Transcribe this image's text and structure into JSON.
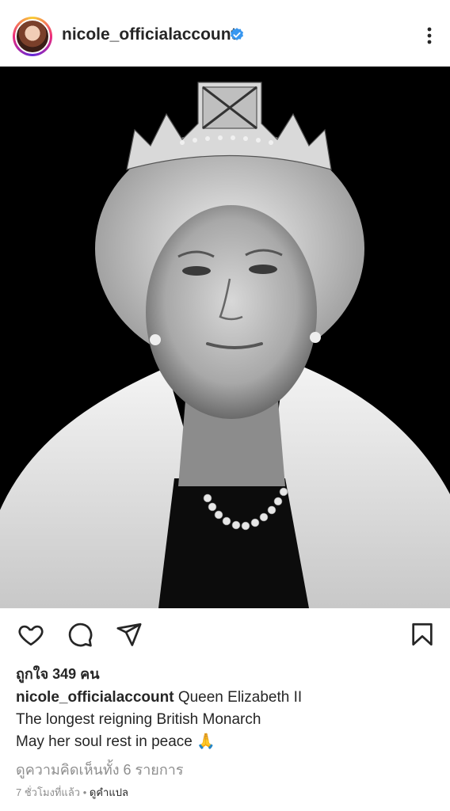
{
  "header": {
    "username": "nicole_officialaccount",
    "verified_icon": "verified-badge-icon",
    "more_icon": "more-vertical-icon"
  },
  "post": {
    "image_icon": "portrait-photo",
    "actions": {
      "like_icon": "heart-icon",
      "comment_icon": "comment-icon",
      "share_icon": "send-icon",
      "save_icon": "bookmark-icon"
    },
    "likes": "ถูกใจ 349 คน",
    "caption": {
      "username": "nicole_officialaccount",
      "line1": " Queen Elizabeth II",
      "line2": "The longest reigning British Monarch",
      "line3": "May her soul rest in peace 🙏"
    },
    "view_comments": "ดูความคิดเห็นทั้ง 6 รายการ",
    "timestamp": "7 ชั่วโมงที่แล้ว",
    "separator": " • ",
    "translate": "ดูคำแปล"
  },
  "colors": {
    "accent": "#3897f0",
    "text": "#262626",
    "muted": "#8e8e8e"
  }
}
